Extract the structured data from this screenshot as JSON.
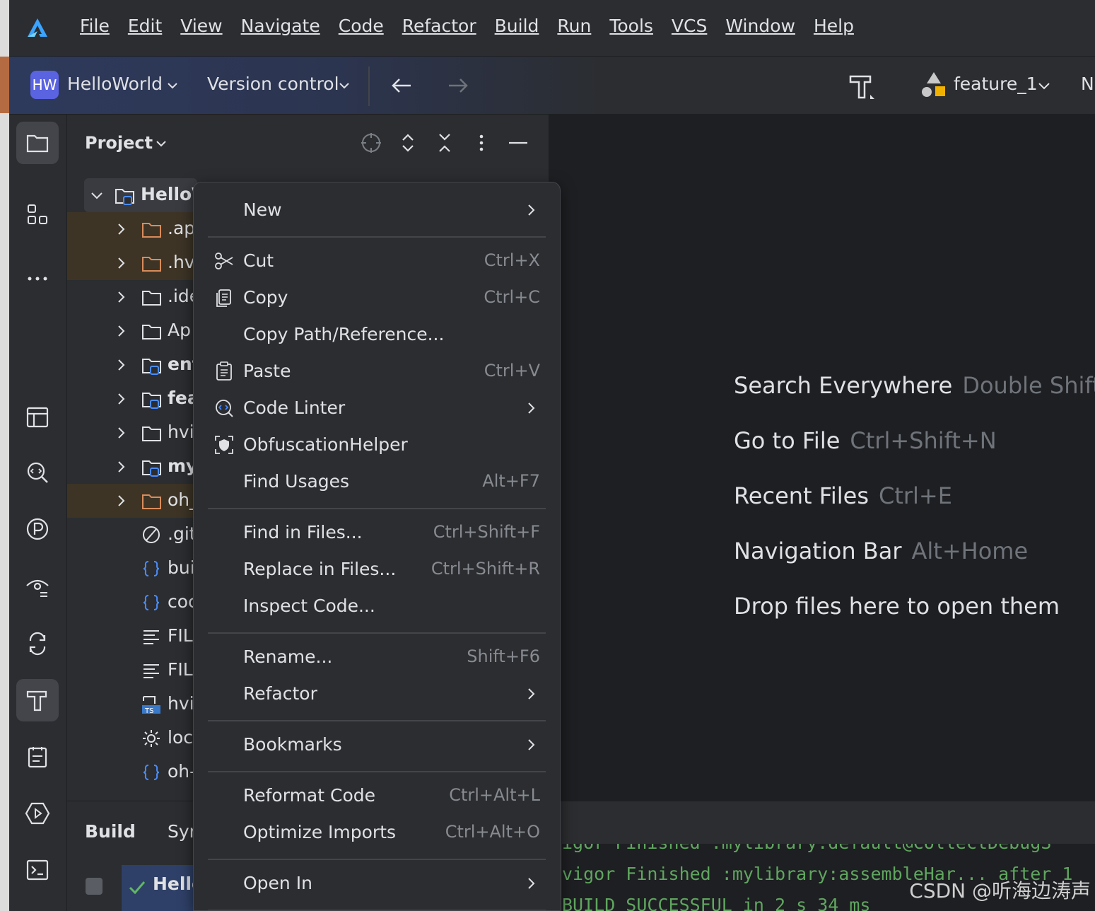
{
  "menubar": {
    "items": [
      "File",
      "Edit",
      "View",
      "Navigate",
      "Code",
      "Refactor",
      "Build",
      "Run",
      "Tools",
      "VCS",
      "Window",
      "Help"
    ]
  },
  "toolbar": {
    "project_badge": "HW",
    "project_name": "HelloWorld",
    "vcs_label": "Version control",
    "branch": "feature_1",
    "cut_off": "N"
  },
  "project_panel": {
    "title": "Project",
    "tree": [
      {
        "label": "Hello\\",
        "icon": "module-folder-icon",
        "expanded": true
      },
      {
        "label": ".ap",
        "icon": "folder-icon",
        "excluded": true
      },
      {
        "label": ".hv",
        "icon": "folder-icon",
        "excluded": true
      },
      {
        "label": ".ide",
        "icon": "folder-icon"
      },
      {
        "label": "Ap",
        "icon": "folder-icon"
      },
      {
        "label": "ent",
        "icon": "module-folder-icon"
      },
      {
        "label": "fea",
        "icon": "module-folder-icon"
      },
      {
        "label": "hvi",
        "icon": "folder-icon"
      },
      {
        "label": "my",
        "icon": "module-folder-icon"
      },
      {
        "label": "oh_",
        "icon": "folder-icon",
        "excluded": true
      },
      {
        "label": ".git",
        "icon": "ignore-icon"
      },
      {
        "label": "bui",
        "icon": "json-icon"
      },
      {
        "label": "coc",
        "icon": "json-icon"
      },
      {
        "label": "FIL",
        "icon": "text-file-icon"
      },
      {
        "label": "FIL",
        "icon": "text-file-icon"
      },
      {
        "label": "hvi",
        "icon": "ts-file-icon"
      },
      {
        "label": "loc",
        "icon": "settings-file-icon"
      },
      {
        "label": "oh-",
        "icon": "json-icon"
      }
    ]
  },
  "editor_hints": [
    {
      "label": "Search Everywhere",
      "shortcut": "Double Shift"
    },
    {
      "label": "Go to File",
      "shortcut": "Ctrl+Shift+N"
    },
    {
      "label": "Recent Files",
      "shortcut": "Ctrl+E"
    },
    {
      "label": "Navigation Bar",
      "shortcut": "Alt+Home"
    },
    {
      "label": "Drop files here to open them",
      "shortcut": ""
    }
  ],
  "build_panel": {
    "tab_build": "Build",
    "tab_sync": "Syn",
    "item_label": "Hello",
    "console_lines": [
      "igor Finished :mylibrary:default@CollectDebugS",
      "vigor Finished :mylibrary:assembleHar... after 1",
      "     BUILD SUCCESSFUL in 2 s 34 ms"
    ]
  },
  "context_menu": {
    "items": [
      {
        "label": "New",
        "shortcut": "",
        "submenu": true,
        "icon": ""
      },
      {
        "sep": true
      },
      {
        "label": "Cut",
        "shortcut": "Ctrl+X",
        "icon": "scissors-icon"
      },
      {
        "label": "Copy",
        "shortcut": "Ctrl+C",
        "icon": "copy-icon"
      },
      {
        "label": "Copy Path/Reference...",
        "shortcut": "",
        "icon": ""
      },
      {
        "label": "Paste",
        "shortcut": "Ctrl+V",
        "icon": "paste-icon"
      },
      {
        "label": "Code Linter",
        "shortcut": "",
        "submenu": true,
        "icon": "code-linter-icon"
      },
      {
        "label": "ObfuscationHelper",
        "shortcut": "",
        "icon": "obfuscation-icon"
      },
      {
        "label": "Find Usages",
        "shortcut": "Alt+F7",
        "icon": ""
      },
      {
        "sep": true
      },
      {
        "label": "Find in Files...",
        "shortcut": "Ctrl+Shift+F",
        "icon": ""
      },
      {
        "label": "Replace in Files...",
        "shortcut": "Ctrl+Shift+R",
        "icon": ""
      },
      {
        "label": "Inspect Code...",
        "shortcut": "",
        "icon": ""
      },
      {
        "sep": true
      },
      {
        "label": "Rename...",
        "shortcut": "Shift+F6",
        "icon": ""
      },
      {
        "label": "Refactor",
        "shortcut": "",
        "submenu": true,
        "icon": ""
      },
      {
        "sep": true
      },
      {
        "label": "Bookmarks",
        "shortcut": "",
        "submenu": true,
        "icon": ""
      },
      {
        "sep": true
      },
      {
        "label": "Reformat Code",
        "shortcut": "Ctrl+Alt+L",
        "icon": ""
      },
      {
        "label": "Optimize Imports",
        "shortcut": "Ctrl+Alt+O",
        "icon": ""
      },
      {
        "sep": true
      },
      {
        "label": "Open In",
        "shortcut": "",
        "submenu": true,
        "icon": ""
      },
      {
        "sep": true
      }
    ]
  },
  "watermark": "CSDN @听海边涛声",
  "colors": {
    "background": "#1e1f22",
    "panel": "#2b2d30",
    "accent": "#5a63e0",
    "excluded_row": "#3d3426",
    "console_green": "#5fa65f",
    "shortcut_gray": "#878a90"
  }
}
